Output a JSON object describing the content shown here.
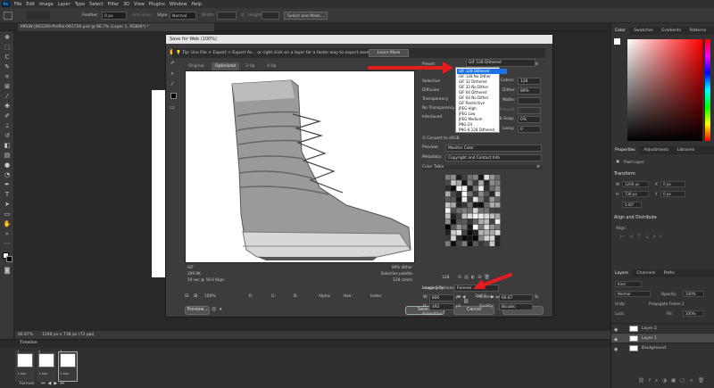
{
  "menubar": {
    "logo": "Ps",
    "items": [
      "File",
      "Edit",
      "Image",
      "Layer",
      "Type",
      "Select",
      "Filter",
      "3D",
      "View",
      "Plugins",
      "Window",
      "Help"
    ]
  },
  "options_bar": {
    "feather_label": "Feather:",
    "feather_value": "0 px",
    "antialias": "Anti-alias",
    "style_label": "Style:",
    "style_value": "Normal",
    "width_label": "Width:",
    "height_label": "Height:",
    "select_mask": "Select and Mask..."
  },
  "document_tab": {
    "title": "MRLW-J002280-Profile-091719.psd @ 66.7% (Layer 1, RGB/8*) *"
  },
  "status_bar": {
    "zoom": "66.67%",
    "info": "1200 px x 738 px (72 ppi)"
  },
  "timeline": {
    "title": "Timeline",
    "frames": [
      {
        "num": "1",
        "delay": "1 sec."
      },
      {
        "num": "2",
        "delay": "1 sec."
      },
      {
        "num": "3",
        "delay": "1 sec."
      }
    ],
    "loop": "Forever"
  },
  "dialog": {
    "title": "Save for Web (100%)",
    "tip": "Tip: Use File > Export > Export As...  or right click on a layer for a faster way to export assets",
    "learn_more": "Learn More",
    "tabs": [
      "Original",
      "Optimized",
      "2-Up",
      "4-Up"
    ],
    "active_tab": "Optimized",
    "preview_info_left": [
      "GIF",
      "269.9K",
      "50 sec @ 56.6 Kbps"
    ],
    "preview_info_right": [
      "89% dither",
      "Selective palette",
      "128 colors"
    ],
    "zoom": "100%",
    "channel_labels": [
      "R:",
      "G:",
      "B:",
      "Alpha:",
      "Hex:",
      "Index:"
    ],
    "preview_btn": "Preview...",
    "save_btn": "Save...",
    "cancel_btn": "Cancel",
    "done_btn": "Done",
    "settings": {
      "preset_label": "Preset:",
      "preset_value": "GIF 128 Dithered",
      "selective": "Selective",
      "diffusion": "Diffusion",
      "transparency": "Transparency",
      "no_trans": "No Transparency",
      "interlaced": "Interlaced",
      "colors_label": "Colors:",
      "colors_value": "128",
      "dither_label": "Dither:",
      "dither_value": "89%",
      "matte_label": "Matte:",
      "amount_label": "Amount:",
      "web_snap_label": "Web Snap:",
      "web_snap_value": "0%",
      "lossy_label": "Lossy:",
      "lossy_value": "0",
      "convert_srgb": "Convert to sRGB",
      "preview_label": "Preview:",
      "preview_value": "Monitor Color",
      "metadata_label": "Metadata:",
      "metadata_value": "Copyright and Contact Info",
      "color_table": "Color Table",
      "table_count": "128",
      "image_size": "Image Size",
      "w_label": "W:",
      "w_value": "800",
      "h_label": "H:",
      "h_value": "492",
      "px": "px",
      "percent_label": "Percent:",
      "percent_value": "66.67",
      "pct": "%",
      "quality_label": "Quality:",
      "quality_value": "Bicubic",
      "animation": "Animation",
      "looping_label": "Looping Options:",
      "looping_value": "Forever",
      "frame_counter": "3 of 3"
    },
    "preset_options": [
      "GIF 128 Dithered",
      "GIF 128 No Dither",
      "GIF 32 Dithered",
      "GIF 32 No Dither",
      "GIF 64 Dithered",
      "GIF 64 No Dither",
      "GIF Restrictive",
      "JPEG High",
      "JPEG Low",
      "JPEG Medium",
      "PNG-24",
      "PNG-8 128 Dithered"
    ],
    "selected_preset": "GIF 128 Dithered"
  },
  "right_panels": {
    "color_tabs": [
      "Color",
      "Swatches",
      "Gradients",
      "Patterns"
    ],
    "props_tabs": [
      "Properties",
      "Adjustments",
      "Libraries"
    ],
    "pixel_layer": "Pixel Layer",
    "transform": "Transform",
    "w_label": "W",
    "w_value": "1200 px",
    "h_label": "H",
    "h_value": "738 px",
    "x_label": "X",
    "x_value": "0 px",
    "y_label": "Y",
    "y_value": "0 px",
    "angle": "0.00°",
    "align": "Align and Distribute",
    "align_sub": "Align:",
    "layers_tabs": [
      "Layers",
      "Channels",
      "Paths"
    ],
    "kind": "Kind",
    "blend": "Normal",
    "opacity_label": "Opacity:",
    "opacity_value": "100%",
    "unify": "Unify:",
    "propagate": "Propagate Frame 1",
    "lock": "Lock:",
    "fill_label": "Fill:",
    "fill_value": "100%",
    "layers": [
      {
        "name": "Layer 2",
        "selected": false
      },
      {
        "name": "Layer 1",
        "selected": true
      },
      {
        "name": "Background",
        "selected": false
      }
    ]
  },
  "colors": {
    "accent": "#1f73e8",
    "arrow": "#e31d1d",
    "hue_top": "#ff0000"
  }
}
